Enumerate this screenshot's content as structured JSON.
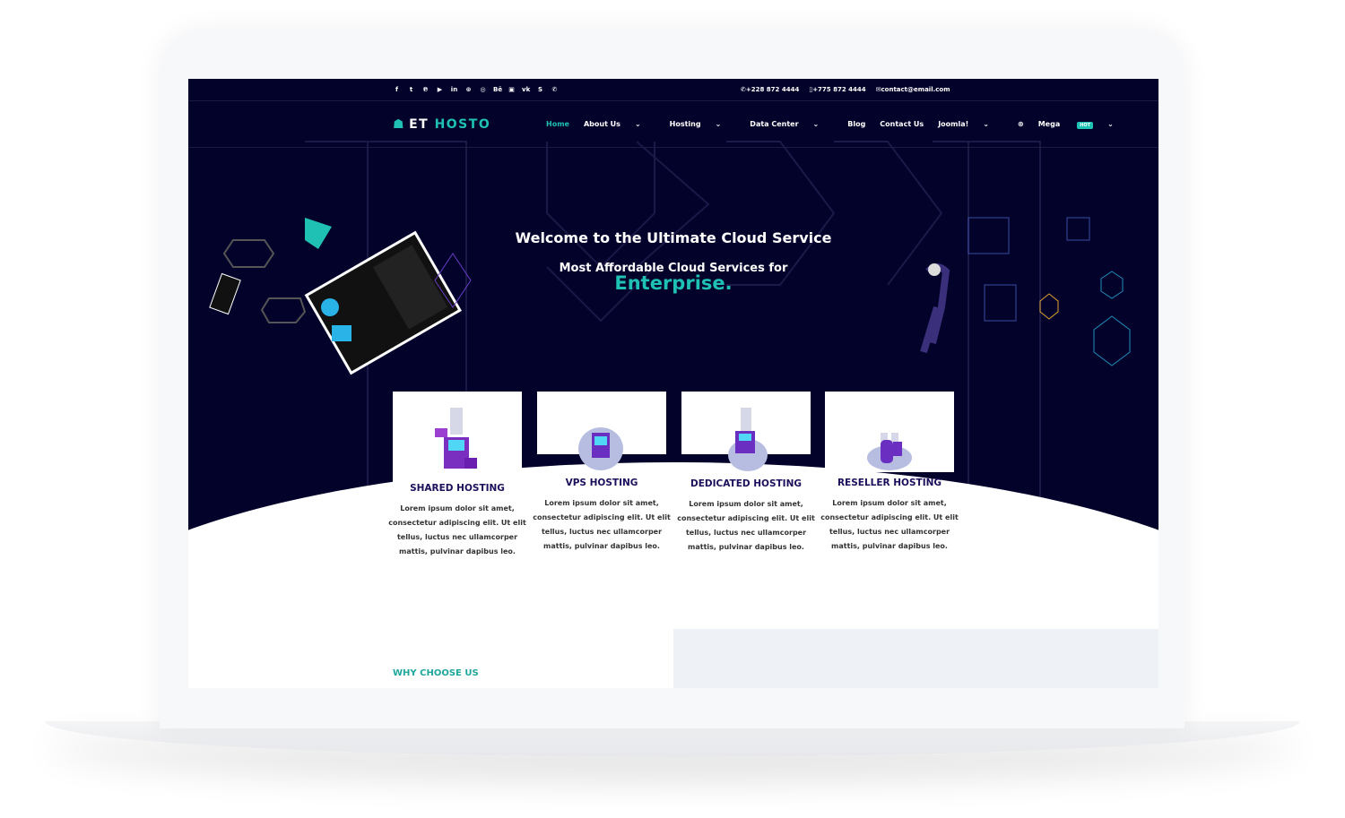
{
  "topbar": {
    "social_icons": [
      "facebook-icon",
      "twitter-icon",
      "pinterest-icon",
      "youtube-icon",
      "linkedin-icon",
      "dribbble-icon",
      "instagram-icon",
      "behance-icon",
      "flickr-icon",
      "vk-icon",
      "skype-icon",
      "whatsapp-icon"
    ],
    "behance": "Bē",
    "phone1": "+228 872 4444",
    "phone2": "+775 872 4444",
    "email": "contact@email.com"
  },
  "nav": {
    "logo_a": "ET",
    "logo_b": "HOSTO",
    "items": [
      "Home",
      "About Us",
      "Hosting",
      "Data Center",
      "Blog",
      "Contact Us",
      "Joomla!",
      "Mega"
    ],
    "hot_badge": "HOT"
  },
  "hero": {
    "title": "Welcome to the Ultimate Cloud Service",
    "subtitle": "Most Affordable Cloud Services for",
    "highlight": "Enterprise."
  },
  "cards": [
    {
      "title": "SHARED HOSTING",
      "text": "Lorem ipsum dolor sit amet, consectetur adipiscing elit. Ut elit tellus, luctus nec ullamcorper mattis, pulvinar dapibus leo."
    },
    {
      "title": "VPS HOSTING",
      "text": "Lorem ipsum dolor sit amet, consectetur adipiscing elit. Ut elit tellus, luctus nec ullamcorper mattis, pulvinar dapibus leo."
    },
    {
      "title": "DEDICATED HOSTING",
      "text": "Lorem ipsum dolor sit amet, consectetur adipiscing elit. Ut elit tellus, luctus nec ullamcorper mattis, pulvinar dapibus leo."
    },
    {
      "title": "RESELLER HOSTING",
      "text": "Lorem ipsum dolor sit amet, consectetur adipiscing elit. Ut elit tellus, luctus nec ullamcorper mattis, pulvinar dapibus leo."
    }
  ],
  "why": {
    "label": "WHY CHOOSE US"
  },
  "colors": {
    "navy": "#03022b",
    "accent": "#1ec1b3",
    "card_title": "#1e0f5c"
  }
}
